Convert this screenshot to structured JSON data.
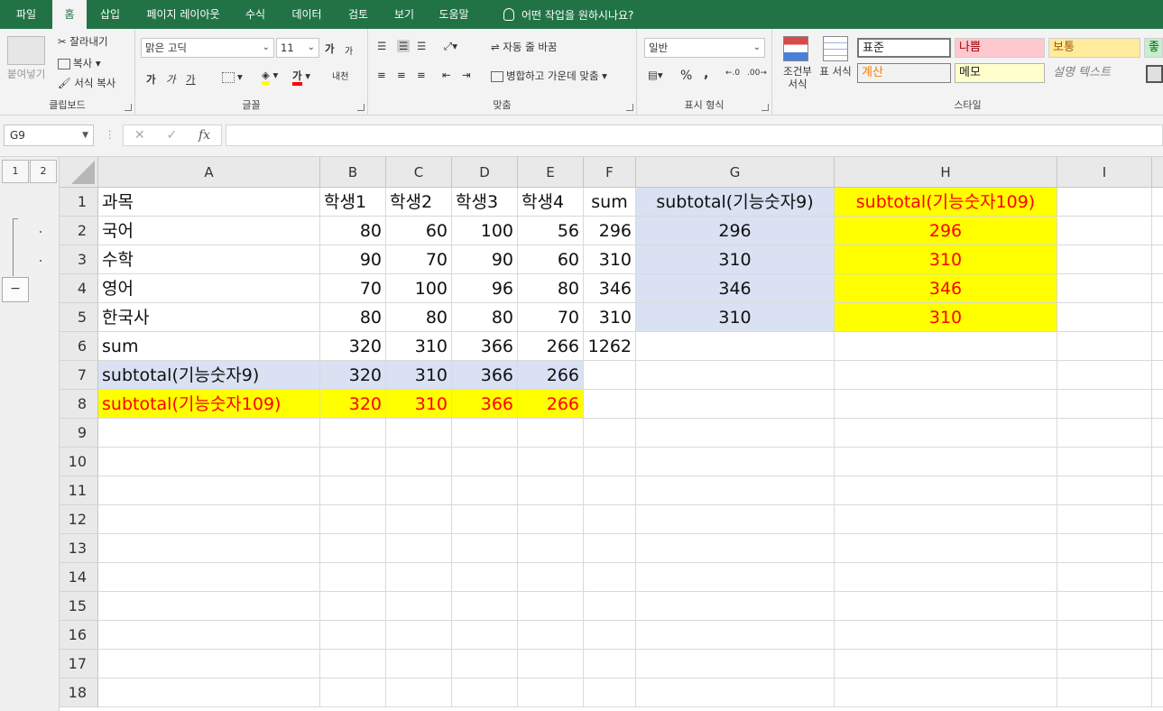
{
  "ribbon_tabs": [
    {
      "label": "파일",
      "active": false
    },
    {
      "label": "홈",
      "active": true
    },
    {
      "label": "삽입",
      "active": false
    },
    {
      "label": "페이지 레이아웃",
      "active": false
    },
    {
      "label": "수식",
      "active": false
    },
    {
      "label": "데이터",
      "active": false
    },
    {
      "label": "검토",
      "active": false
    },
    {
      "label": "보기",
      "active": false
    },
    {
      "label": "도움말",
      "active": false
    }
  ],
  "tell_me": "어떤 작업을 원하시나요?",
  "clipboard": {
    "paste": "붙여넣기",
    "cut": "잘라내기",
    "copy": "복사",
    "format_painter": "서식 복사",
    "label": "클립보드"
  },
  "font": {
    "name": "맑은 고딕",
    "size": "11",
    "label": "글꼴",
    "bold": "가",
    "italic": "가",
    "underline": "가",
    "grow": "가",
    "shrink": "가",
    "phonetic": "내천"
  },
  "alignment": {
    "wrap": "자동 줄 바꿈",
    "merge": "병합하고 가운데 맞춤",
    "label": "맞춤"
  },
  "number": {
    "format": "일반",
    "percent": "%",
    "comma": ",",
    "label": "표시 형식"
  },
  "styles": {
    "conditional": "조건부 서식",
    "table": "표 서식",
    "normal": "표준",
    "bad": "나쁨",
    "neutral": "보통",
    "good": "좋",
    "calculation": "계산",
    "note": "메모",
    "explanatory": "설명 텍스트",
    "label": "스타일"
  },
  "formula_bar": {
    "name_box": "G9",
    "fx": "fx",
    "cancel": "✕",
    "enter": "✓",
    "value": ""
  },
  "outline_levels": [
    "1",
    "2"
  ],
  "outline_collapse": "−",
  "columns": [
    "A",
    "B",
    "C",
    "D",
    "E",
    "F",
    "G",
    "H",
    "I"
  ],
  "rows": [
    "1",
    "2",
    "3",
    "4",
    "5",
    "6",
    "7",
    "8",
    "9",
    "10",
    "11",
    "12",
    "13",
    "14",
    "15",
    "16",
    "17",
    "18"
  ],
  "sheet": {
    "header": [
      "과목",
      "학생1",
      "학생2",
      "학생3",
      "학생4",
      "sum",
      "subtotal(기능숫자9)",
      "subtotal(기능숫자109)"
    ],
    "data": [
      [
        "국어",
        "80",
        "60",
        "100",
        "56",
        "296",
        "296",
        "296"
      ],
      [
        "수학",
        "90",
        "70",
        "90",
        "60",
        "310",
        "310",
        "310"
      ],
      [
        "영어",
        "70",
        "100",
        "96",
        "80",
        "346",
        "346",
        "346"
      ],
      [
        "한국사",
        "80",
        "80",
        "80",
        "70",
        "310",
        "310",
        "310"
      ]
    ],
    "sum_row": [
      "sum",
      "320",
      "310",
      "366",
      "266",
      "1262"
    ],
    "subtotal9_row": [
      "subtotal(기능숫자9)",
      "320",
      "310",
      "366",
      "266"
    ],
    "subtotal109_row": [
      "subtotal(기능숫자109)",
      "320",
      "310",
      "366",
      "266"
    ]
  },
  "colors": {
    "excel_green": "#217346",
    "subtotal9_fill": "#d9e1f2",
    "subtotal109_fill": "#ffff00",
    "subtotal109_text": "#ff0000"
  }
}
